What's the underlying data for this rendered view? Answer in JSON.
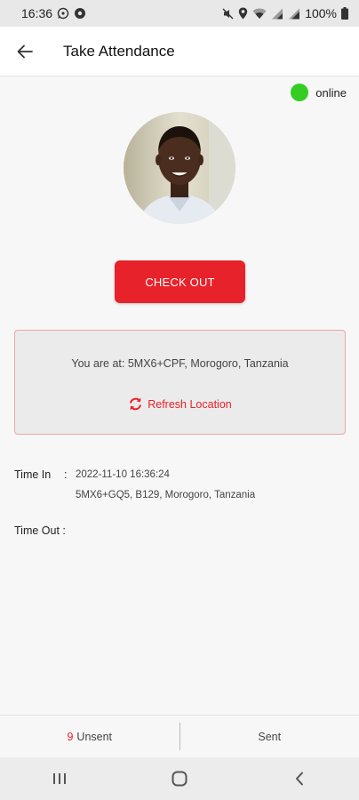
{
  "status_bar": {
    "time": "16:36",
    "battery": "100%",
    "icons": [
      "whatsapp-icon",
      "settings-icon",
      "mute-icon",
      "location-icon",
      "wifi-icon",
      "signal-icon",
      "signal-icon",
      "battery-icon"
    ]
  },
  "app_bar": {
    "title": "Take Attendance",
    "back_icon": "arrow-left-icon"
  },
  "connection": {
    "status": "online",
    "color": "#35cd22"
  },
  "profile": {
    "avatar": "user-photo"
  },
  "actions": {
    "checkout_label": "CHECK OUT",
    "checkout_color": "#e8222a"
  },
  "location": {
    "current": "You are at: 5MX6+CPF, Morogoro, Tanzania",
    "refresh_label": "Refresh Location",
    "refresh_icon": "refresh-icon"
  },
  "attendance": {
    "time_in_label": "Time In",
    "time_in_separator": ":",
    "time_in_value": "2022-11-10 16:36:24",
    "time_in_location": "5MX6+GQ5, B129, Morogoro, Tanzania",
    "time_out_label": "Time Out :"
  },
  "tabs": {
    "unsent_count": "9",
    "unsent_label": "Unsent",
    "sent_label": "Sent"
  },
  "system_nav": {
    "recents_icon": "recents-icon",
    "home_icon": "home-icon",
    "back_icon": "back-chevron-icon"
  }
}
